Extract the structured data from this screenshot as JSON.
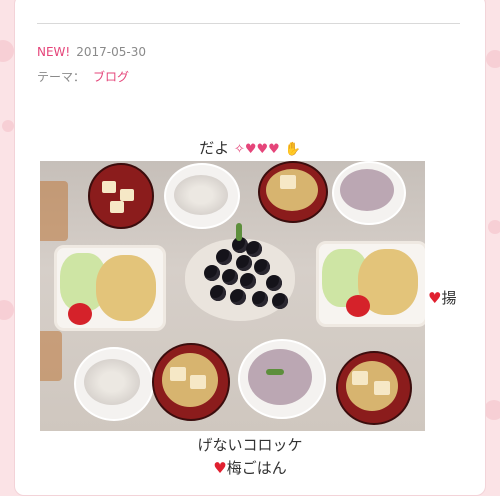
{
  "post": {
    "new_label": "NEW!",
    "date": "2017-05-30",
    "theme_label": "テーマ：",
    "theme_value": "ブログ"
  },
  "body": {
    "line1_text": "だよ",
    "line2_tail": "揚",
    "line3_text": "げないコロッケ",
    "line4_text": "梅ごはん"
  },
  "colors": {
    "accent": "#e5457a",
    "heart": "#e0202f",
    "background": "#fbe3e6"
  },
  "icons": [
    "heart-icon",
    "sparkle-heart-icon",
    "hand-icon"
  ]
}
